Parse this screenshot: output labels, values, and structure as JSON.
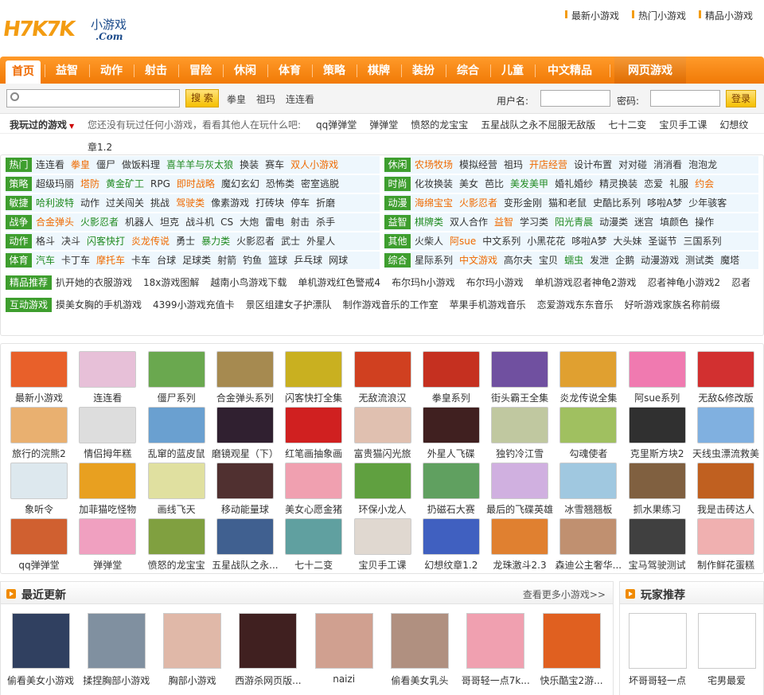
{
  "logo": {
    "main": "H7K7K",
    "cn": "小游戏",
    "dom": ".Com"
  },
  "toplinks": [
    "最新小游戏",
    "热门小游戏",
    "精品小游戏"
  ],
  "nav": {
    "items": [
      "首页",
      "益智",
      "动作",
      "射击",
      "冒险",
      "休闲",
      "体育",
      "策略",
      "棋牌",
      "装扮",
      "综合",
      "儿童",
      "中文精品"
    ],
    "net": "网页游戏"
  },
  "search": {
    "button": "搜 索",
    "keywords": [
      "拳皇",
      "祖玛",
      "连连看"
    ],
    "user_label": "用户名:",
    "pass_label": "密码:",
    "login": "登录"
  },
  "played": {
    "title": "我玩过的游戏",
    "hint": "您还没有玩过任何小游戏，看看其他人在玩什么吧:",
    "games": [
      "qq弹弹堂",
      "弹弹堂",
      "愤怒的龙宝宝",
      "五星战队之永不屈服无敌版",
      "七十二变",
      "宝贝手工课",
      "幻想纹"
    ],
    "extra": "章1.2"
  },
  "cats": [
    {
      "label": "热门",
      "items": [
        {
          "t": "连连看"
        },
        {
          "t": "拳皇",
          "c": "o"
        },
        {
          "t": "僵尸"
        },
        {
          "t": "做饭料理"
        },
        {
          "t": "喜羊羊与灰太狼",
          "c": "g"
        },
        {
          "t": "换装"
        },
        {
          "t": "赛车"
        },
        {
          "t": "双人小游戏",
          "c": "o"
        }
      ]
    },
    {
      "label": "休闲",
      "items": [
        {
          "t": "农场牧场",
          "c": "o"
        },
        {
          "t": "模拟经营"
        },
        {
          "t": "祖玛"
        },
        {
          "t": "开店经营",
          "c": "o"
        },
        {
          "t": "设计布置"
        },
        {
          "t": "对对碰"
        },
        {
          "t": "消消看"
        },
        {
          "t": "泡泡龙"
        }
      ]
    },
    {
      "label": "策略",
      "items": [
        {
          "t": "超级玛丽"
        },
        {
          "t": "塔防",
          "c": "o"
        },
        {
          "t": "黄金矿工",
          "c": "g"
        },
        {
          "t": "RPG"
        },
        {
          "t": "即时战略",
          "c": "o"
        },
        {
          "t": "魔幻玄幻"
        },
        {
          "t": "恐怖类"
        },
        {
          "t": "密室逃脱"
        }
      ]
    },
    {
      "label": "时尚",
      "items": [
        {
          "t": "化妆换装"
        },
        {
          "t": "美女"
        },
        {
          "t": "芭比"
        },
        {
          "t": "美发美甲",
          "c": "g"
        },
        {
          "t": "婚礼婚纱"
        },
        {
          "t": "精灵换装"
        },
        {
          "t": "恋爱"
        },
        {
          "t": "礼服"
        },
        {
          "t": "约会",
          "c": "o"
        }
      ]
    },
    {
      "label": "敏捷",
      "items": [
        {
          "t": "哈利波特",
          "c": "g"
        },
        {
          "t": "动作"
        },
        {
          "t": "过关闯关"
        },
        {
          "t": "挑战"
        },
        {
          "t": "驾驶类",
          "c": "o"
        },
        {
          "t": "像素游戏"
        },
        {
          "t": "打砖块"
        },
        {
          "t": "停车"
        },
        {
          "t": "折磨"
        }
      ]
    },
    {
      "label": "动漫",
      "items": [
        {
          "t": "海绵宝宝",
          "c": "o"
        },
        {
          "t": "火影忍者",
          "c": "o"
        },
        {
          "t": "变形金刚"
        },
        {
          "t": "猫和老鼠"
        },
        {
          "t": "史酷比系列"
        },
        {
          "t": "哆啦A梦"
        },
        {
          "t": "少年骇客"
        }
      ]
    },
    {
      "label": "战争",
      "items": [
        {
          "t": "合金弹头",
          "c": "o"
        },
        {
          "t": "火影忍者",
          "c": "g"
        },
        {
          "t": "机器人"
        },
        {
          "t": "坦克"
        },
        {
          "t": "战斗机"
        },
        {
          "t": "CS"
        },
        {
          "t": "大炮"
        },
        {
          "t": "雷电"
        },
        {
          "t": "射击"
        },
        {
          "t": "杀手"
        }
      ]
    },
    {
      "label": "益智",
      "items": [
        {
          "t": "棋牌类",
          "c": "g"
        },
        {
          "t": "双人合作"
        },
        {
          "t": "益智",
          "c": "o"
        },
        {
          "t": "学习类"
        },
        {
          "t": "阳光青晨",
          "c": "g"
        },
        {
          "t": "动漫类"
        },
        {
          "t": "迷宫"
        },
        {
          "t": "填颜色"
        },
        {
          "t": "操作"
        }
      ]
    },
    {
      "label": "动作",
      "items": [
        {
          "t": "格斗"
        },
        {
          "t": "决斗"
        },
        {
          "t": "闪客快打",
          "c": "g"
        },
        {
          "t": "炎龙传说",
          "c": "o"
        },
        {
          "t": "勇士"
        },
        {
          "t": "暴力类",
          "c": "g"
        },
        {
          "t": "火影忍者"
        },
        {
          "t": "武士"
        },
        {
          "t": "外星人"
        }
      ]
    },
    {
      "label": "其他",
      "items": [
        {
          "t": "火柴人"
        },
        {
          "t": "阿sue",
          "c": "o"
        },
        {
          "t": "中文系列"
        },
        {
          "t": "小黑花花"
        },
        {
          "t": "哆啦A梦"
        },
        {
          "t": "大头妹"
        },
        {
          "t": "圣诞节"
        },
        {
          "t": "三国系列"
        }
      ]
    },
    {
      "label": "体育",
      "items": [
        {
          "t": "汽车",
          "c": "g"
        },
        {
          "t": "卡丁车"
        },
        {
          "t": "摩托车",
          "c": "o"
        },
        {
          "t": "卡车"
        },
        {
          "t": "台球"
        },
        {
          "t": "足球类"
        },
        {
          "t": "射箭"
        },
        {
          "t": "钓鱼"
        },
        {
          "t": "篮球"
        },
        {
          "t": "乒乓球"
        },
        {
          "t": "网球"
        }
      ]
    },
    {
      "label": "综合",
      "items": [
        {
          "t": "星际系列"
        },
        {
          "t": "中文游戏",
          "c": "o"
        },
        {
          "t": "高尔夫"
        },
        {
          "t": "宝贝"
        },
        {
          "t": "蠕虫",
          "c": "g"
        },
        {
          "t": "发泄"
        },
        {
          "t": "企鹅"
        },
        {
          "t": "动漫游戏"
        },
        {
          "t": "测试类"
        },
        {
          "t": "魔塔"
        }
      ]
    },
    {
      "label": "精品推荐",
      "items": [
        {
          "t": "扒开她的衣服游戏"
        },
        {
          "t": "18x游戏图解"
        },
        {
          "t": "越南小鸟游戏下载"
        },
        {
          "t": "单机游戏红色警戒4"
        },
        {
          "t": "布尔玛h小游戏"
        },
        {
          "t": "布尔玛小游戏"
        },
        {
          "t": "单机游戏忍者神龟2游戏"
        },
        {
          "t": "忍者神龟小游戏2"
        },
        {
          "t": "忍者"
        }
      ]
    },
    {
      "label": "互动游戏",
      "items": [
        {
          "t": "摸美女胸的手机游戏"
        },
        {
          "t": "4399小游戏充值卡"
        },
        {
          "t": "景区组建女子护漂队"
        },
        {
          "t": "制作游戏音乐的工作室"
        },
        {
          "t": "苹果手机游戏音乐"
        },
        {
          "t": "恋爱游戏东东音乐"
        },
        {
          "t": "好听游戏家族名称前缀"
        }
      ]
    }
  ],
  "games": [
    {
      "t": "最新小游戏",
      "c": "#e8602a"
    },
    {
      "t": "连连看",
      "c": "#e7c0d8"
    },
    {
      "t": "僵尸系列",
      "c": "#6aa84f"
    },
    {
      "t": "合金弹头系列",
      "c": "#a68a50"
    },
    {
      "t": "闪客快打全集",
      "c": "#c9b020"
    },
    {
      "t": "无敌流浪汉",
      "c": "#d04020"
    },
    {
      "t": "拳皇系列",
      "c": "#c53020"
    },
    {
      "t": "街头霸王全集",
      "c": "#7050a0"
    },
    {
      "t": "炎龙传说全集",
      "c": "#e0a030"
    },
    {
      "t": "阿sue系列",
      "c": "#f07ab0"
    },
    {
      "t": "无敌&修改版",
      "c": "#d23030"
    },
    {
      "t": "旅行的浣熊2",
      "c": "#e9b070"
    },
    {
      "t": "情侣拇年糕",
      "c": "#dddddd"
    },
    {
      "t": "乱窜的蓝皮鼠",
      "c": "#6aa0d0"
    },
    {
      "t": "磨镜观星（下）",
      "c": "#302030"
    },
    {
      "t": "红笔画抽象画",
      "c": "#d02020"
    },
    {
      "t": "富贵猫闪光旅",
      "c": "#e0c0b0"
    },
    {
      "t": "外星人飞碟",
      "c": "#402020"
    },
    {
      "t": "独钓冷江雪",
      "c": "#c0c8a0"
    },
    {
      "t": "勾魂使者",
      "c": "#a0c060"
    },
    {
      "t": "克里斯方块2",
      "c": "#303030"
    },
    {
      "t": "天线虫漂流救美",
      "c": "#80b0e0"
    },
    {
      "t": "象听令",
      "c": "#dde8ee"
    },
    {
      "t": "加菲猫吃怪物",
      "c": "#e8a020"
    },
    {
      "t": "画线飞天",
      "c": "#e0e0a0"
    },
    {
      "t": "移动能量球",
      "c": "#503030"
    },
    {
      "t": "美女心愿金猪",
      "c": "#f0a0b0"
    },
    {
      "t": "环保小龙人",
      "c": "#60a040"
    },
    {
      "t": "扔磁石大赛",
      "c": "#60a060"
    },
    {
      "t": "最后的飞碟英雄",
      "c": "#d0b0e0"
    },
    {
      "t": "冰雪翘翘板",
      "c": "#a0c8e0"
    },
    {
      "t": "抓水果练习",
      "c": "#806040"
    },
    {
      "t": "我是击砖达人",
      "c": "#c06020"
    },
    {
      "t": "qq弹弹堂",
      "c": "#d06030"
    },
    {
      "t": "弹弹堂",
      "c": "#f0a0c0"
    },
    {
      "t": "愤怒的龙宝宝",
      "c": "#80a040"
    },
    {
      "t": "五星战队之永...",
      "c": "#406090"
    },
    {
      "t": "七十二变",
      "c": "#60a0a0"
    },
    {
      "t": "宝贝手工课",
      "c": "#e0d8d0"
    },
    {
      "t": "幻想纹章1.2",
      "c": "#4060c0"
    },
    {
      "t": "龙珠激斗2.3",
      "c": "#e08030"
    },
    {
      "t": "森迪公主奢华...",
      "c": "#c09070"
    },
    {
      "t": "宝马驾驶测试",
      "c": "#404040"
    },
    {
      "t": "制作鲜花蛋糕",
      "c": "#f0b0b0"
    }
  ],
  "recent": {
    "title": "最近更新",
    "more": "查看更多小游戏>>",
    "items": [
      {
        "t": "偷看美女小游戏",
        "c": "#304060"
      },
      {
        "t": "揉捏胸部小游戏",
        "c": "#8090a0"
      },
      {
        "t": "胸部小游戏",
        "c": "#e0b8a8"
      },
      {
        "t": "西游杀网页版...",
        "c": "#402020"
      },
      {
        "t": "naizi",
        "c": "#d0a090"
      },
      {
        "t": "偷看美女乳头",
        "c": "#b09080"
      },
      {
        "t": "哥哥轻一点7k...",
        "c": "#f0a0b0"
      },
      {
        "t": "快乐酷宝2游...",
        "c": "#e06020"
      }
    ]
  },
  "players": {
    "title": "玩家推荐",
    "items": [
      "坏哥哥轻一点",
      "宅男最爱"
    ]
  }
}
